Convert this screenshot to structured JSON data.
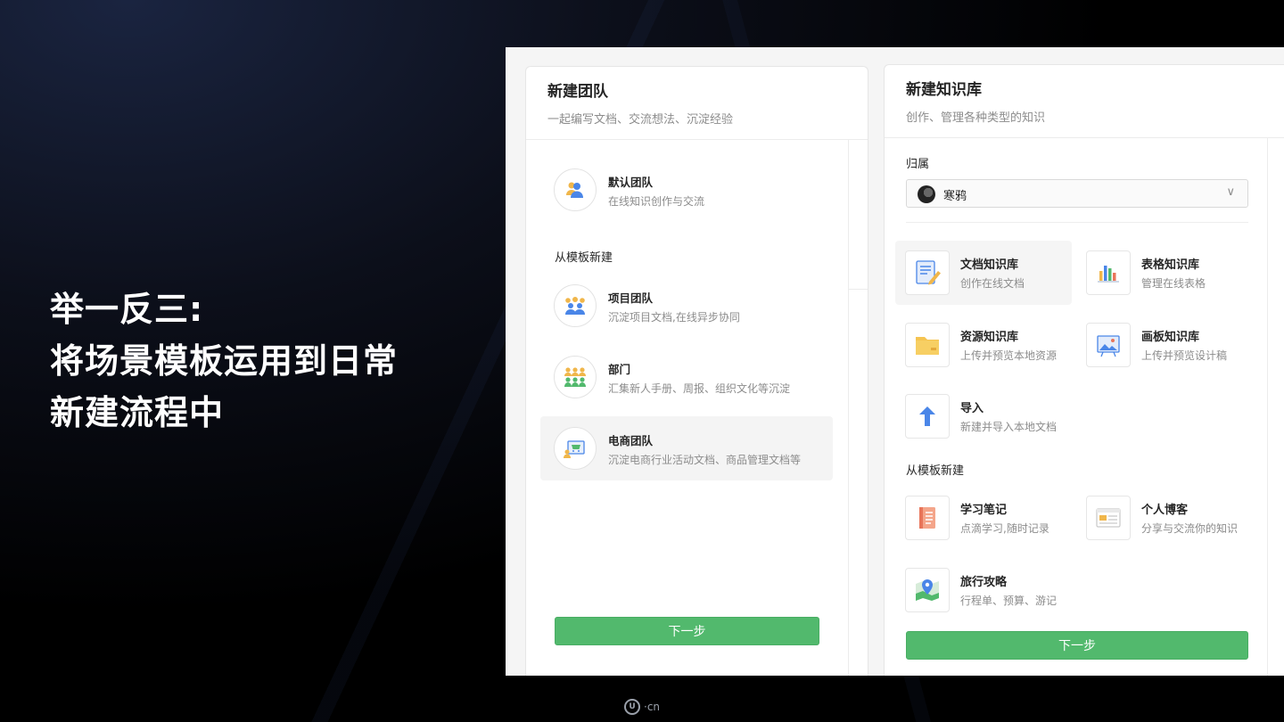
{
  "headline": {
    "line1": "举一反三:",
    "line2": "将场景模板运用到日常",
    "line3": "新建流程中"
  },
  "left_panel": {
    "title": "新建团队",
    "subtitle": "一起编写文档、交流想法、沉淀经验",
    "default_team": {
      "name": "默认团队",
      "desc": "在线知识创作与交流"
    },
    "template_section": "从模板新建",
    "templates": [
      {
        "name": "项目团队",
        "desc": "沉淀项目文档,在线异步协同"
      },
      {
        "name": "部门",
        "desc": "汇集新人手册、周报、组织文化等沉淀"
      },
      {
        "name": "电商团队",
        "desc": "沉淀电商行业活动文档、商品管理文档等"
      }
    ],
    "next_button": "下一步"
  },
  "right_panel": {
    "title": "新建知识库",
    "subtitle": "创作、管理各种类型的知识",
    "owner_label": "归属",
    "owner_value": "寒鸦",
    "types": [
      {
        "name": "文档知识库",
        "desc": "创作在线文档"
      },
      {
        "name": "表格知识库",
        "desc": "管理在线表格"
      },
      {
        "name": "资源知识库",
        "desc": "上传并预览本地资源"
      },
      {
        "name": "画板知识库",
        "desc": "上传并预览设计稿"
      },
      {
        "name": "导入",
        "desc": "新建并导入本地文档"
      }
    ],
    "template_section": "从模板新建",
    "templates": [
      {
        "name": "学习笔记",
        "desc": "点滴学习,随时记录"
      },
      {
        "name": "个人博客",
        "desc": "分享与交流你的知识"
      },
      {
        "name": "旅行攻略",
        "desc": "行程单、预算、游记"
      }
    ],
    "next_button": "下一步"
  },
  "watermark": "·cn",
  "colors": {
    "accent_green": "#52b96d",
    "background": "#000000"
  }
}
